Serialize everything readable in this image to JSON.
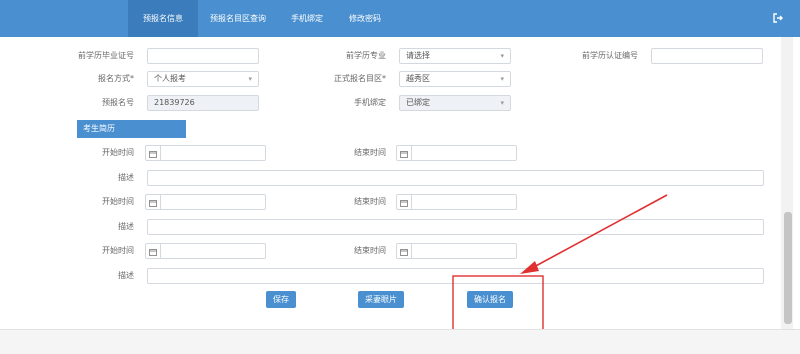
{
  "nav": {
    "tabs": [
      {
        "label": "预报名信息",
        "active": true
      },
      {
        "label": "预报名目区查询",
        "active": false
      },
      {
        "label": "手机绑定",
        "active": false
      },
      {
        "label": "修改密码",
        "active": false
      }
    ],
    "logout_icon": "logout-icon"
  },
  "form": {
    "prev_cert_label": "前学历毕业证号",
    "prev_major_label": "前学历专业",
    "prev_major_value": "请选择",
    "prev_auth_label": "前学历认证编号",
    "reg_method_label": "报名方式*",
    "reg_method_value": "个人报考",
    "district_label": "正式报名目区*",
    "district_value": "越秀区",
    "pre_reg_no_label": "预报名号",
    "pre_reg_no_value": "21839726",
    "phone_bind_label": "手机绑定",
    "phone_bind_value": "已绑定"
  },
  "resume": {
    "section_title": "考生简历",
    "start_label": "开始时间",
    "end_label": "结束时间",
    "desc_label": "描述",
    "entry_count": 3
  },
  "actions": {
    "save": "保存",
    "cancel": "采妻眼片",
    "confirm": "确认报名"
  },
  "colors": {
    "nav_bg": "#4a90d0",
    "button_bg": "#4a90d0",
    "highlight": "#e03030"
  }
}
